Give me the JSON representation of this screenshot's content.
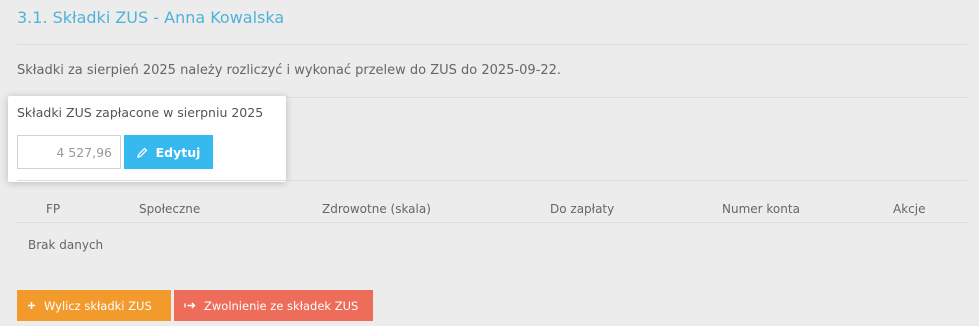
{
  "page": {
    "title": "3.1. Składki ZUS - Anna Kowalska",
    "info": "Składki za sierpień 2025 należy rozliczyć i wykonać przelew do ZUS do 2025-09-22."
  },
  "card": {
    "label": "Składki ZUS zapłacone w sierpniu 2025",
    "amount": "4 527,96",
    "edit_label": "Edytuj",
    "edit_icon": "pencil-icon"
  },
  "table": {
    "columns": [
      "FP",
      "Społeczne",
      "Zdrowotne (skala)",
      "Do zapłaty",
      "Numer konta",
      "Akcje"
    ],
    "empty_text": "Brak danych"
  },
  "actions": {
    "calculate_label": "Wylicz składki ZUS",
    "calculate_icon": "plus-icon",
    "exemption_label": "Zwolnienie ze składek ZUS",
    "exemption_icon": "exit-arrow-icon"
  },
  "colors": {
    "title": "#4fb3d9",
    "edit_button": "#36b9ee",
    "calculate_button": "#f39a2c",
    "exemption_button": "#ee6c5a"
  }
}
